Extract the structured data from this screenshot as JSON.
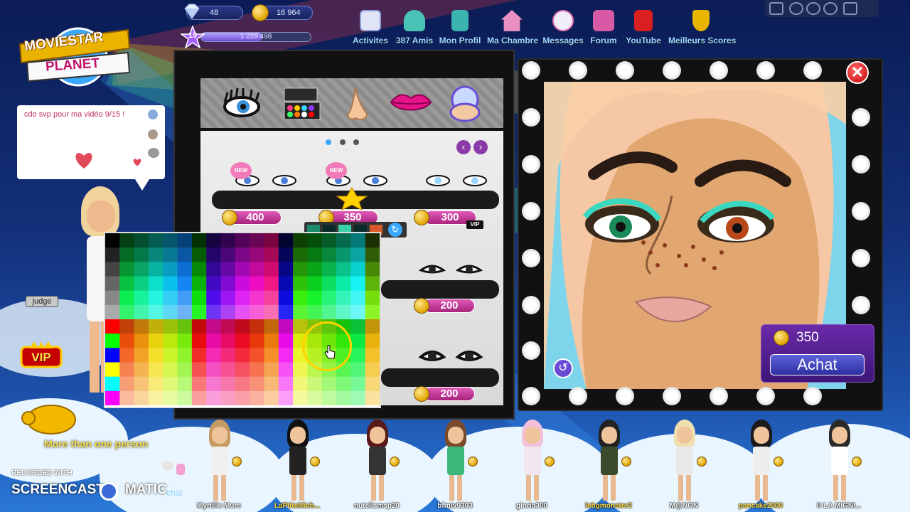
{
  "topbar": {
    "diamonds": "48",
    "coins": "16 964",
    "level": "19",
    "fame": "1 228 498"
  },
  "nav": [
    {
      "label": "Activites",
      "icon": "clipboard-icon",
      "color": "#dfe4f7"
    },
    {
      "label": "387 Amis",
      "icon": "friends-icon",
      "color": "#49c3b6"
    },
    {
      "label": "Mon Profil",
      "icon": "notebook-icon",
      "color": "#3bb4b0"
    },
    {
      "label": "Ma Chambre",
      "icon": "house-icon",
      "color": "#e98fc2"
    },
    {
      "label": "Messages",
      "icon": "chat-bubble-icon",
      "color": "#f2eef9"
    },
    {
      "label": "Forum",
      "icon": "forum-icon",
      "color": "#d85aa6"
    },
    {
      "label": "YouTube",
      "icon": "youtube-icon",
      "color": "#d91f1f"
    },
    {
      "label": "Meilleurs Scores",
      "icon": "trophy-icon",
      "color": "#e8b400"
    }
  ],
  "logo": {
    "line1": "MOVIESTAR",
    "line2": "PLANET"
  },
  "chat": {
    "message": "cdo svp pour ma vidéo 9/15 !",
    "user_tag": "judge"
  },
  "vip_badge": "VIP",
  "more_than_one": "More than one person",
  "chat_link": "chat",
  "makeup": {
    "categories": [
      "eyelashes-icon",
      "eyeshadow-palette-icon",
      "nose-icon",
      "lips-icon",
      "powder-compact-icon"
    ],
    "items": [
      {
        "price": "400",
        "new": "NEW",
        "vip": false
      },
      {
        "price": "350",
        "new": "NEW",
        "vip": false
      },
      {
        "price": "300",
        "new": "",
        "vip": true
      },
      {
        "price": "200",
        "new": "",
        "vip": false
      },
      {
        "price": "200",
        "new": "",
        "vip": false
      }
    ],
    "vip_tag": "VIP"
  },
  "mirror": {
    "price": "350",
    "buy_label": "Achat",
    "close_label": "✕"
  },
  "friends": [
    "Myrtille Mure",
    "LaPtiteMich...",
    "nutellamsp20",
    "bfmtv9303",
    "gloria300",
    "lebgmonster2",
    "M@NON",
    "pancake2000",
    "!! LA MIGNI..."
  ],
  "watermark": {
    "recorded": "RECORDED WITH",
    "brand_left": "SCREENCAST",
    "brand_right": "MATIC"
  },
  "colors": {
    "accent_pink": "#c2307f",
    "accent_purple": "#4a1f8c",
    "nav_text": "#9fd8ff",
    "close_red": "#d00000"
  }
}
